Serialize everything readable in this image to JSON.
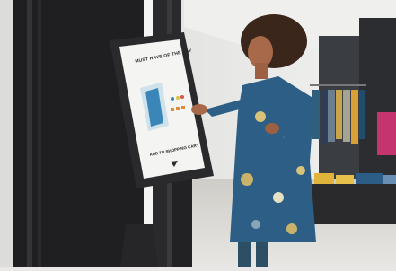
{
  "scene": {
    "description_icons": [
      "kiosk-icon",
      "woman-icon",
      "clothing-rack-icon"
    ],
    "colors": {
      "wall_dark": "#1e1e1e",
      "floor": "#d9d7d3",
      "dress": "#2d5e86",
      "kiosk_frame": "#2a2a2c",
      "screen": "#f4f4f2"
    }
  },
  "kiosk": {
    "title": "MUST HAVE OF THE DAY",
    "footer": "ADD TO SHOPPING CART"
  }
}
